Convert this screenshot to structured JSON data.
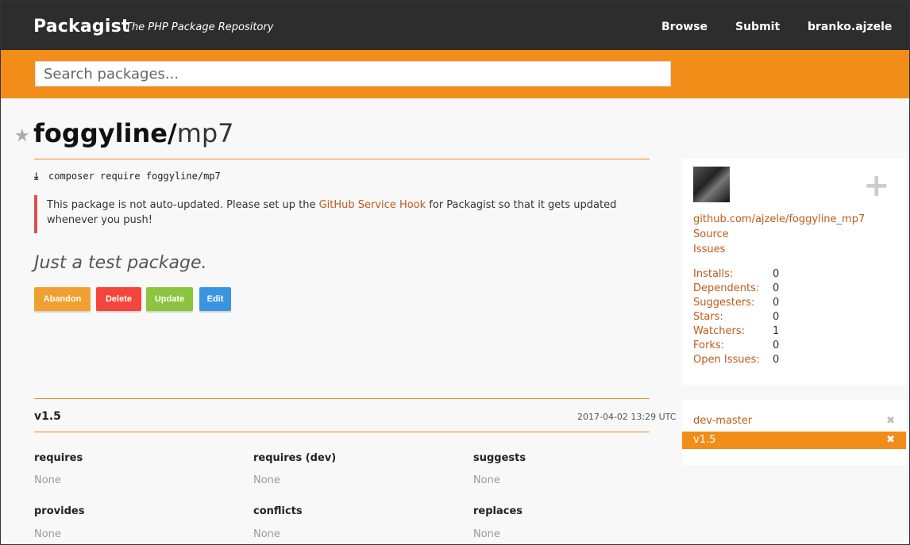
{
  "header": {
    "logo": "Packagist",
    "tagline": "The PHP Package Repository",
    "nav": {
      "browse": "Browse",
      "submit": "Submit",
      "user": "branko.ajzele"
    }
  },
  "search": {
    "placeholder": "Search packages..."
  },
  "package": {
    "vendor": "foggyline/",
    "name": "mp7",
    "install_command": "composer require foggyline/mp7",
    "alert": {
      "prefix": "This package is not auto-updated. Please set up the ",
      "link": "GitHub Service Hook",
      "suffix": " for Packagist so that it gets updated whenever you push!"
    },
    "description": "Just a test package.",
    "actions": {
      "abandon": "Abandon",
      "delete": "Delete",
      "update": "Update",
      "edit": "Edit"
    }
  },
  "sidebar": {
    "repo_link": "github.com/ajzele/foggyline_mp7",
    "source": "Source",
    "issues": "Issues",
    "stats": [
      {
        "label": "Installs:",
        "value": "0"
      },
      {
        "label": "Dependents:",
        "value": "0"
      },
      {
        "label": "Suggesters:",
        "value": "0"
      },
      {
        "label": "Stars:",
        "value": "0"
      },
      {
        "label": "Watchers:",
        "value": "1"
      },
      {
        "label": "Forks:",
        "value": "0"
      },
      {
        "label": "Open Issues:",
        "value": "0"
      }
    ]
  },
  "version": {
    "title": "v1.5",
    "date": "2017-04-02 13:29 UTC",
    "deps": [
      {
        "head": "requires",
        "value": "None"
      },
      {
        "head": "requires (dev)",
        "value": "None"
      },
      {
        "head": "suggests",
        "value": "None"
      },
      {
        "head": "provides",
        "value": "None"
      },
      {
        "head": "conflicts",
        "value": "None"
      },
      {
        "head": "replaces",
        "value": "None"
      }
    ]
  },
  "versions_list": [
    {
      "label": "dev-master",
      "remove": "✖"
    },
    {
      "label": "v1.5",
      "remove": "✖"
    }
  ],
  "colors": {
    "accent": "#f28d1a",
    "dark": "#2d2d2d",
    "link": "#c05a19"
  }
}
